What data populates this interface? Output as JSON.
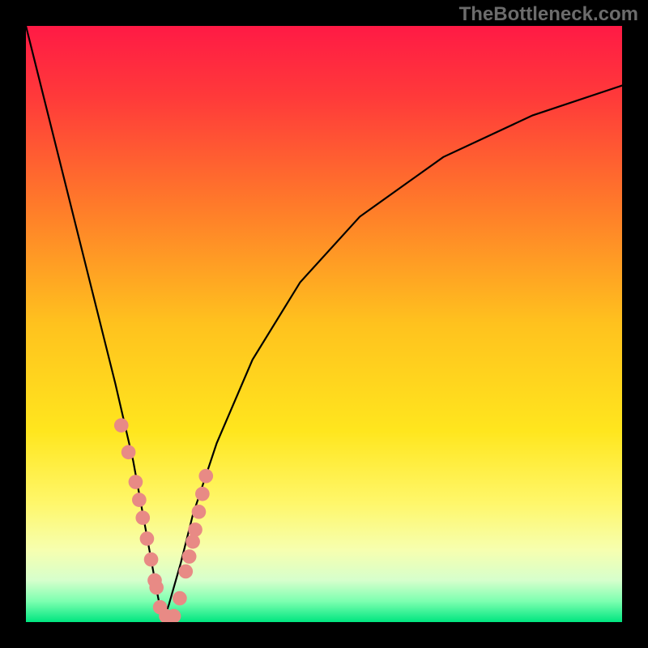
{
  "watermark": "TheBottleneck.com",
  "chart_data": {
    "type": "line",
    "title": "",
    "xlabel": "",
    "ylabel": "",
    "xlim": [
      0,
      100
    ],
    "ylim": [
      0,
      100
    ],
    "x_min_at": 23,
    "series": [
      {
        "name": "bottleneck-curve",
        "x": [
          0,
          3,
          6,
          9,
          12,
          15,
          18,
          20,
          22,
          23,
          24,
          26,
          28,
          32,
          38,
          46,
          56,
          70,
          85,
          100
        ],
        "y": [
          100,
          88,
          76,
          64,
          52,
          40,
          27,
          16,
          5,
          0,
          3,
          10,
          18,
          30,
          44,
          57,
          68,
          78,
          85,
          90
        ]
      }
    ],
    "markers": {
      "name": "sample-points",
      "x": [
        16.0,
        17.2,
        18.4,
        19.0,
        19.6,
        20.3,
        21.0,
        21.6,
        21.9,
        22.5,
        23.5,
        24.8,
        25.8,
        26.8,
        27.4,
        28.0,
        28.4,
        29.0,
        29.6,
        30.2
      ],
      "y": [
        33.0,
        28.5,
        23.5,
        20.5,
        17.5,
        14.0,
        10.5,
        7.0,
        5.8,
        2.5,
        1.0,
        1.0,
        4.0,
        8.5,
        11.0,
        13.5,
        15.5,
        18.5,
        21.5,
        24.5
      ]
    },
    "gradient_stops": [
      {
        "offset": 0.0,
        "color": "#ff1a45"
      },
      {
        "offset": 0.12,
        "color": "#ff3a3a"
      },
      {
        "offset": 0.3,
        "color": "#ff7a2a"
      },
      {
        "offset": 0.5,
        "color": "#ffc21e"
      },
      {
        "offset": 0.68,
        "color": "#ffe61e"
      },
      {
        "offset": 0.8,
        "color": "#fff76a"
      },
      {
        "offset": 0.88,
        "color": "#f6ffb0"
      },
      {
        "offset": 0.93,
        "color": "#d6ffcc"
      },
      {
        "offset": 0.965,
        "color": "#7dffb0"
      },
      {
        "offset": 1.0,
        "color": "#00e680"
      }
    ],
    "marker_style": {
      "fill": "#e88a85",
      "r_frac": 0.012
    }
  }
}
